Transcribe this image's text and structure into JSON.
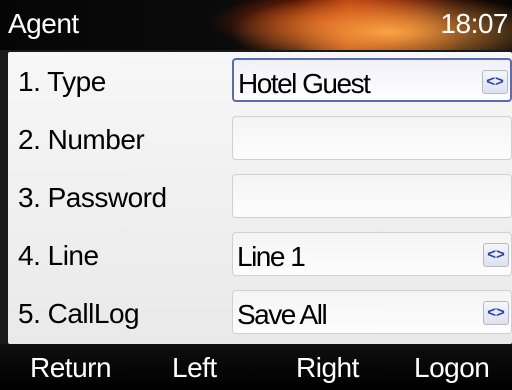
{
  "header": {
    "title": "Agent",
    "time": "18:07"
  },
  "form": {
    "rows": [
      {
        "label": "1.  Type",
        "value": "Hotel Guest",
        "has_selector": true,
        "focused": true,
        "icon": "left-right-arrows-icon",
        "selector_glyph": "<>"
      },
      {
        "label": "2.  Number",
        "value": "",
        "has_selector": false,
        "focused": false
      },
      {
        "label": "3.  Password",
        "value": "",
        "has_selector": false,
        "focused": false
      },
      {
        "label": "4.  Line",
        "value": "Line 1",
        "has_selector": true,
        "focused": false,
        "icon": "left-right-arrows-icon",
        "selector_glyph": "<>"
      },
      {
        "label": "5.  CallLog",
        "value": "Save All",
        "has_selector": true,
        "focused": false,
        "icon": "left-right-arrows-icon",
        "selector_glyph": "<>"
      }
    ]
  },
  "softkeys": {
    "return": "Return",
    "left": "Left",
    "right": "Right",
    "logon": "Logon"
  },
  "colors": {
    "focus_border": "#5b6ab8",
    "arrow_glyph": "#2a3cae",
    "title_bg_accent": "#b3350a"
  }
}
